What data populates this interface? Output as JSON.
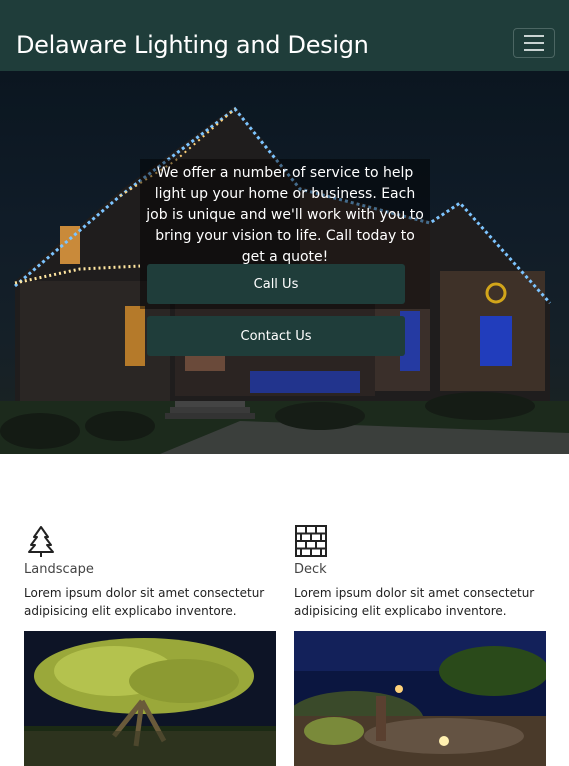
{
  "navbar": {
    "brand": "Delaware Lighting and Design",
    "menu_icon": "hamburger-menu-icon"
  },
  "hero": {
    "text": "We offer a number of service to help light up your home or business. Each job is unique and we'll work with you to bring your vision to life. Call today to get a quote!",
    "call_button": "Call Us",
    "contact_button": "Contact Us"
  },
  "features": [
    {
      "icon": "tree-icon",
      "title": "Landscape",
      "description": "Lorem ipsum dolor sit amet consectetur adipisicing elit explicabo inventore."
    },
    {
      "icon": "brick-wall-icon",
      "title": "Deck",
      "description": "Lorem ipsum dolor sit amet consectetur adipisicing elit explicabo inventore."
    }
  ],
  "colors": {
    "brand_dark_green": "#1f3d3a",
    "light_blue": "#5aa8ff",
    "warm_light": "#ffd27a"
  }
}
